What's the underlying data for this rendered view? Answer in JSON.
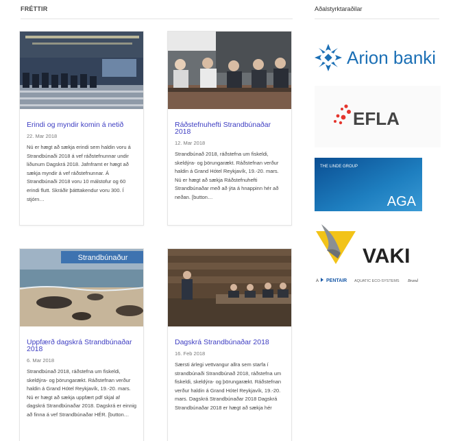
{
  "news": {
    "heading": "FRÉTTIR",
    "articles": [
      {
        "title": "Erindi og myndir komin á netið",
        "date": "22. Mar 2018",
        "excerpt": "Nú er hægt að sækja erindi sem haldin voru á Strandbúnaði 2018 á vef ráðstefnunnar undir liðunum Dagskrá 2018. Jafnframt er hægt að sækja myndir á vef ráðstefnunnar. Á Strandbúnaði 2018 voru 10 málstofur og 60 erindi flutt. Skráðir þátttakendur voru 300. Í stjórn…"
      },
      {
        "title": "Ráðstefnuhefti Strandbúnaðar 2018",
        "date": "12. Mar 2018",
        "excerpt": "Strandbúnað 2018, ráðstefna um fiskeldi, skeldýra- og þörungarækt. Ráðstefnan verður haldin á Grand Hótel Reykjavík, 19.-20. mars. Nú er hægt að sækja Ráðstefnuhefti Strandbúnaðar með að ýta á hnappinn hér að neðan. [button…"
      },
      {
        "title": "Uppfærð dagskrá Strandbúnaðar 2018",
        "date": "6. Mar 2018",
        "image_caption": "Strandbúnaður",
        "excerpt": "Strandbúnað 2018, ráðstefna um fiskeldi, skeldýra- og þörungarækt. Ráðstefnan verður haldin á Grand Hótel Reykjavík, 19.-20. mars. Nú er hægt að sækja uppfært pdf skjal af dagskrá Strandbúnaðar 2018. Dagskrá er einnig að finna á vef Strandbúnaðar HÉR. [button…"
      },
      {
        "title": "Dagskrá Strandbúnaðar 2018",
        "date": "16. Feb 2018",
        "excerpt": "Særsti árlegi vettvangur allra sem starfa í strandbúnaði Strandbúnað 2018, ráðstefna um fiskeldi, skeldýra- og þörungarækt. Ráðstefnan verður haldin á Grand Hótel Reykjavík, 19.-20. mars. Dagskrá Strandbúnaðar 2018 Dagskrá Strandbúnaðar 2018 er hægt að sækja hér"
      }
    ]
  },
  "sponsors": {
    "heading": "Aðalstyrktaraðilar",
    "items": [
      {
        "name": "Arion banki",
        "color": "#1b6fb5"
      },
      {
        "name": "EFLA",
        "color": "#e4352d"
      },
      {
        "name": "AGA",
        "group": "THE LINDE GROUP",
        "color": "#1e7fc0"
      },
      {
        "name": "VAKI",
        "byline_prefix": "A",
        "byline_brand": "PENTAIR",
        "byline_suffix": "AQUATIC ECO-SYSTEMS",
        "byline_tag": "Brand",
        "color": "#f2c318"
      }
    ]
  }
}
